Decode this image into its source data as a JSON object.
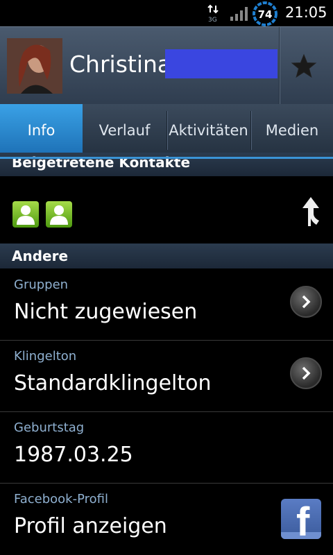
{
  "status_bar": {
    "network": "3G",
    "battery": "74",
    "time": "21:05"
  },
  "header": {
    "contact_name": "Christina",
    "icons": {
      "avatar": "contact-photo",
      "favorite": "star-icon"
    }
  },
  "tabs": [
    {
      "label": "Info",
      "active": true
    },
    {
      "label": "Verlauf",
      "active": false
    },
    {
      "label": "Aktivitäten",
      "active": false
    },
    {
      "label": "Medien",
      "active": false
    }
  ],
  "sections": {
    "joined_contacts": {
      "title": "Beigetretene Kontakte",
      "icons": [
        "person-icon",
        "person-icon",
        "split-arrow-icon"
      ]
    },
    "other": {
      "title": "Andere"
    }
  },
  "items": [
    {
      "label": "Gruppen",
      "value": "Nicht zugewiesen",
      "action_icon": "chevron-right-icon"
    },
    {
      "label": "Klingelton",
      "value": "Standardklingelton",
      "action_icon": "chevron-right-icon"
    },
    {
      "label": "Geburtstag",
      "value": "1987.03.25"
    },
    {
      "label": "Facebook-Profil",
      "value": "Profil anzeigen",
      "action_icon": "facebook-icon"
    }
  ],
  "colors": {
    "accent": "#2a8ad6",
    "label_blue": "#8fb0d0",
    "redaction": "#3a46e0",
    "person_icon": "#6cbf22"
  }
}
